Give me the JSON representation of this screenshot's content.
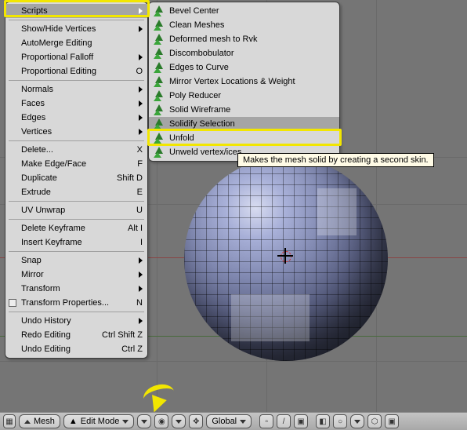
{
  "menu": {
    "items": [
      {
        "label": "Scripts",
        "arrow": true,
        "hl": true
      },
      {
        "sep": true
      },
      {
        "label": "Show/Hide Vertices",
        "arrow": true
      },
      {
        "label": "AutoMerge Editing"
      },
      {
        "label": "Proportional Falloff",
        "arrow": true
      },
      {
        "label": "Proportional Editing",
        "shortcut": "O"
      },
      {
        "sep": true
      },
      {
        "label": "Normals",
        "arrow": true
      },
      {
        "label": "Faces",
        "arrow": true
      },
      {
        "label": "Edges",
        "arrow": true
      },
      {
        "label": "Vertices",
        "arrow": true
      },
      {
        "sep": true
      },
      {
        "label": "Delete...",
        "shortcut": "X"
      },
      {
        "label": "Make Edge/Face",
        "shortcut": "F"
      },
      {
        "label": "Duplicate",
        "shortcut": "Shift D"
      },
      {
        "label": "Extrude",
        "shortcut": "E"
      },
      {
        "sep": true
      },
      {
        "label": "UV Unwrap",
        "shortcut": "U"
      },
      {
        "sep": true
      },
      {
        "label": "Delete Keyframe",
        "shortcut": "Alt I"
      },
      {
        "label": "Insert Keyframe",
        "shortcut": "I"
      },
      {
        "sep": true
      },
      {
        "label": "Snap",
        "arrow": true
      },
      {
        "label": "Mirror",
        "arrow": true
      },
      {
        "label": "Transform",
        "arrow": true
      },
      {
        "label": "Transform Properties...",
        "shortcut": "N",
        "chk": true
      },
      {
        "sep": true
      },
      {
        "label": "Undo History",
        "arrow": true
      },
      {
        "label": "Redo Editing",
        "shortcut": "Ctrl Shift Z"
      },
      {
        "label": "Undo Editing",
        "shortcut": "Ctrl Z"
      }
    ]
  },
  "submenu": {
    "items": [
      {
        "label": "Bevel Center"
      },
      {
        "label": "Clean Meshes"
      },
      {
        "label": "Deformed mesh to Rvk"
      },
      {
        "label": "Discombobulator"
      },
      {
        "label": "Edges to Curve"
      },
      {
        "label": "Mirror Vertex Locations & Weight"
      },
      {
        "label": "Poly Reducer"
      },
      {
        "label": "Solid Wireframe"
      },
      {
        "label": "Solidify Selection",
        "hl": true
      },
      {
        "label": "Unfold"
      },
      {
        "label": "Unweld vertex/ices"
      }
    ]
  },
  "tooltip": "Makes the mesh solid by creating a second skin.",
  "header": {
    "mesh": "Mesh",
    "mode": "Edit Mode",
    "orient": "Global"
  }
}
